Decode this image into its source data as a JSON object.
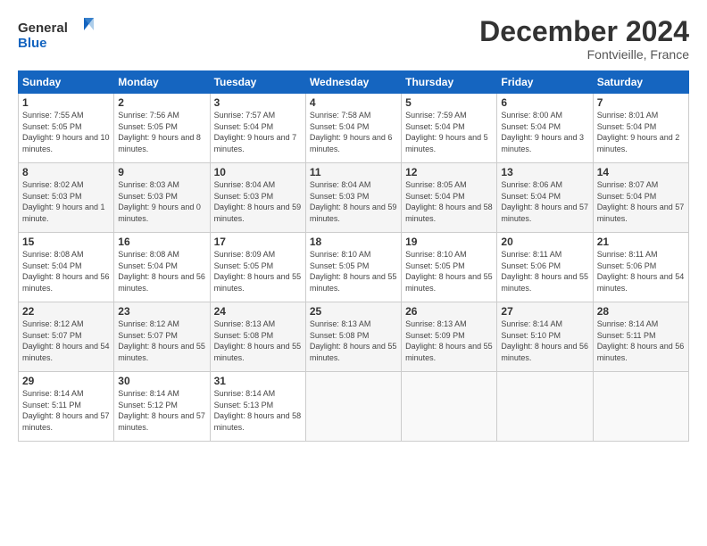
{
  "logo": {
    "line1": "General",
    "line2": "Blue"
  },
  "title": "December 2024",
  "location": "Fontvieille, France",
  "header": {
    "days": [
      "Sunday",
      "Monday",
      "Tuesday",
      "Wednesday",
      "Thursday",
      "Friday",
      "Saturday"
    ]
  },
  "weeks": [
    [
      {
        "day": "1",
        "sunrise": "Sunrise: 7:55 AM",
        "sunset": "Sunset: 5:05 PM",
        "daylight": "Daylight: 9 hours and 10 minutes."
      },
      {
        "day": "2",
        "sunrise": "Sunrise: 7:56 AM",
        "sunset": "Sunset: 5:05 PM",
        "daylight": "Daylight: 9 hours and 8 minutes."
      },
      {
        "day": "3",
        "sunrise": "Sunrise: 7:57 AM",
        "sunset": "Sunset: 5:04 PM",
        "daylight": "Daylight: 9 hours and 7 minutes."
      },
      {
        "day": "4",
        "sunrise": "Sunrise: 7:58 AM",
        "sunset": "Sunset: 5:04 PM",
        "daylight": "Daylight: 9 hours and 6 minutes."
      },
      {
        "day": "5",
        "sunrise": "Sunrise: 7:59 AM",
        "sunset": "Sunset: 5:04 PM",
        "daylight": "Daylight: 9 hours and 5 minutes."
      },
      {
        "day": "6",
        "sunrise": "Sunrise: 8:00 AM",
        "sunset": "Sunset: 5:04 PM",
        "daylight": "Daylight: 9 hours and 3 minutes."
      },
      {
        "day": "7",
        "sunrise": "Sunrise: 8:01 AM",
        "sunset": "Sunset: 5:04 PM",
        "daylight": "Daylight: 9 hours and 2 minutes."
      }
    ],
    [
      {
        "day": "8",
        "sunrise": "Sunrise: 8:02 AM",
        "sunset": "Sunset: 5:03 PM",
        "daylight": "Daylight: 9 hours and 1 minute."
      },
      {
        "day": "9",
        "sunrise": "Sunrise: 8:03 AM",
        "sunset": "Sunset: 5:03 PM",
        "daylight": "Daylight: 9 hours and 0 minutes."
      },
      {
        "day": "10",
        "sunrise": "Sunrise: 8:04 AM",
        "sunset": "Sunset: 5:03 PM",
        "daylight": "Daylight: 8 hours and 59 minutes."
      },
      {
        "day": "11",
        "sunrise": "Sunrise: 8:04 AM",
        "sunset": "Sunset: 5:03 PM",
        "daylight": "Daylight: 8 hours and 59 minutes."
      },
      {
        "day": "12",
        "sunrise": "Sunrise: 8:05 AM",
        "sunset": "Sunset: 5:04 PM",
        "daylight": "Daylight: 8 hours and 58 minutes."
      },
      {
        "day": "13",
        "sunrise": "Sunrise: 8:06 AM",
        "sunset": "Sunset: 5:04 PM",
        "daylight": "Daylight: 8 hours and 57 minutes."
      },
      {
        "day": "14",
        "sunrise": "Sunrise: 8:07 AM",
        "sunset": "Sunset: 5:04 PM",
        "daylight": "Daylight: 8 hours and 57 minutes."
      }
    ],
    [
      {
        "day": "15",
        "sunrise": "Sunrise: 8:08 AM",
        "sunset": "Sunset: 5:04 PM",
        "daylight": "Daylight: 8 hours and 56 minutes."
      },
      {
        "day": "16",
        "sunrise": "Sunrise: 8:08 AM",
        "sunset": "Sunset: 5:04 PM",
        "daylight": "Daylight: 8 hours and 56 minutes."
      },
      {
        "day": "17",
        "sunrise": "Sunrise: 8:09 AM",
        "sunset": "Sunset: 5:05 PM",
        "daylight": "Daylight: 8 hours and 55 minutes."
      },
      {
        "day": "18",
        "sunrise": "Sunrise: 8:10 AM",
        "sunset": "Sunset: 5:05 PM",
        "daylight": "Daylight: 8 hours and 55 minutes."
      },
      {
        "day": "19",
        "sunrise": "Sunrise: 8:10 AM",
        "sunset": "Sunset: 5:05 PM",
        "daylight": "Daylight: 8 hours and 55 minutes."
      },
      {
        "day": "20",
        "sunrise": "Sunrise: 8:11 AM",
        "sunset": "Sunset: 5:06 PM",
        "daylight": "Daylight: 8 hours and 55 minutes."
      },
      {
        "day": "21",
        "sunrise": "Sunrise: 8:11 AM",
        "sunset": "Sunset: 5:06 PM",
        "daylight": "Daylight: 8 hours and 54 minutes."
      }
    ],
    [
      {
        "day": "22",
        "sunrise": "Sunrise: 8:12 AM",
        "sunset": "Sunset: 5:07 PM",
        "daylight": "Daylight: 8 hours and 54 minutes."
      },
      {
        "day": "23",
        "sunrise": "Sunrise: 8:12 AM",
        "sunset": "Sunset: 5:07 PM",
        "daylight": "Daylight: 8 hours and 55 minutes."
      },
      {
        "day": "24",
        "sunrise": "Sunrise: 8:13 AM",
        "sunset": "Sunset: 5:08 PM",
        "daylight": "Daylight: 8 hours and 55 minutes."
      },
      {
        "day": "25",
        "sunrise": "Sunrise: 8:13 AM",
        "sunset": "Sunset: 5:08 PM",
        "daylight": "Daylight: 8 hours and 55 minutes."
      },
      {
        "day": "26",
        "sunrise": "Sunrise: 8:13 AM",
        "sunset": "Sunset: 5:09 PM",
        "daylight": "Daylight: 8 hours and 55 minutes."
      },
      {
        "day": "27",
        "sunrise": "Sunrise: 8:14 AM",
        "sunset": "Sunset: 5:10 PM",
        "daylight": "Daylight: 8 hours and 56 minutes."
      },
      {
        "day": "28",
        "sunrise": "Sunrise: 8:14 AM",
        "sunset": "Sunset: 5:11 PM",
        "daylight": "Daylight: 8 hours and 56 minutes."
      }
    ],
    [
      {
        "day": "29",
        "sunrise": "Sunrise: 8:14 AM",
        "sunset": "Sunset: 5:11 PM",
        "daylight": "Daylight: 8 hours and 57 minutes."
      },
      {
        "day": "30",
        "sunrise": "Sunrise: 8:14 AM",
        "sunset": "Sunset: 5:12 PM",
        "daylight": "Daylight: 8 hours and 57 minutes."
      },
      {
        "day": "31",
        "sunrise": "Sunrise: 8:14 AM",
        "sunset": "Sunset: 5:13 PM",
        "daylight": "Daylight: 8 hours and 58 minutes."
      },
      null,
      null,
      null,
      null
    ]
  ]
}
